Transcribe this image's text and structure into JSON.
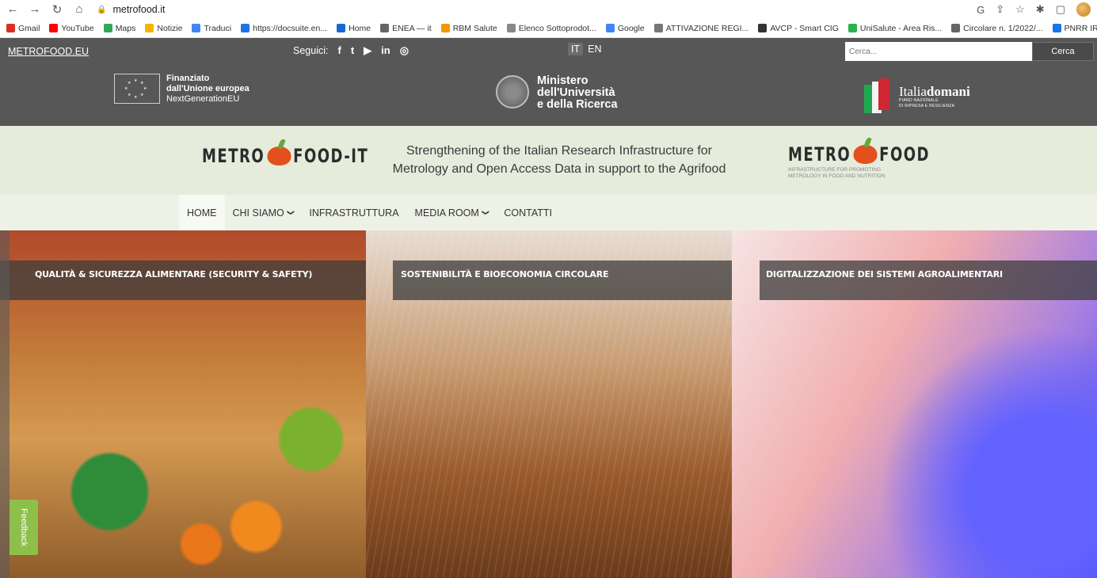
{
  "browser": {
    "url": "metrofood.it",
    "bookmarks": [
      "Gmail",
      "YouTube",
      "Maps",
      "Notizie",
      "Traduci",
      "https://docsuite.en...",
      "Home",
      "ENEA — it",
      "RBM Salute",
      "Elenco Sottoprodot...",
      "Google",
      "ATTIVAZIONE REGI...",
      "AVCP - Smart CIG",
      "UniSalute - Area Ris...",
      "Circolare n. 1/2022/...",
      "PNRR IR - METROF..."
    ],
    "bookmark_colors": [
      "#d93025",
      "#ff0000",
      "#34a853",
      "#f4b400",
      "#4285f4",
      "#1a73e8",
      "#1967d2",
      "#666666",
      "#f29900",
      "#888888",
      "#4285f4",
      "#777777",
      "#333333",
      "#2bb24c",
      "#666666",
      "#1a73e8"
    ]
  },
  "topbar": {
    "brand": "METROFOOD.EU",
    "follow_label": "Seguici:",
    "social": [
      "f",
      "t",
      "▶",
      "in",
      "◎"
    ],
    "languages": [
      "IT",
      "EN"
    ],
    "search_placeholder": "Cerca...",
    "search_button": "Cerca"
  },
  "logos": {
    "eu_line1": "Finanziato",
    "eu_line2": "dall'Unione europea",
    "eu_line3": "NextGenerationEU",
    "mur_line1": "Ministero",
    "mur_line2": "dell'Università",
    "mur_line3": "e della Ricerca",
    "italia": "Italia",
    "domani": "domani",
    "italia_sub1": "PIANO NAZIONALE",
    "italia_sub2": "DI RIPRESA E RESILIENZA"
  },
  "project": {
    "logo_left_a": "METRO",
    "logo_left_b": "FOOD-IT",
    "tagline_1": "Strengthening of the Italian Research Infrastructure for",
    "tagline_2": "Metrology and Open Access Data in support to the Agrifood",
    "logo_right_a": "METRO",
    "logo_right_b": "FOOD",
    "logo_right_sub1": "INFRASTRUCTURE FOR PROMOTING",
    "logo_right_sub2": "METROLOGY IN FOOD AND NUTRITION"
  },
  "nav": {
    "items": [
      "HOME",
      "CHI SIAMO",
      "INFRASTRUTTURA",
      "MEDIA ROOM",
      "CONTATTI"
    ]
  },
  "hero": {
    "panels": [
      "QUALITÀ & SICUREZZA ALIMENTARE (SECURITY & SAFETY)",
      "SOSTENIBILITÀ E BIOECONOMIA CIRCOLARE",
      "DIGITALIZZAZIONE DEI SISTEMI AGROALIMENTARI"
    ],
    "feedback": "Feedback"
  }
}
